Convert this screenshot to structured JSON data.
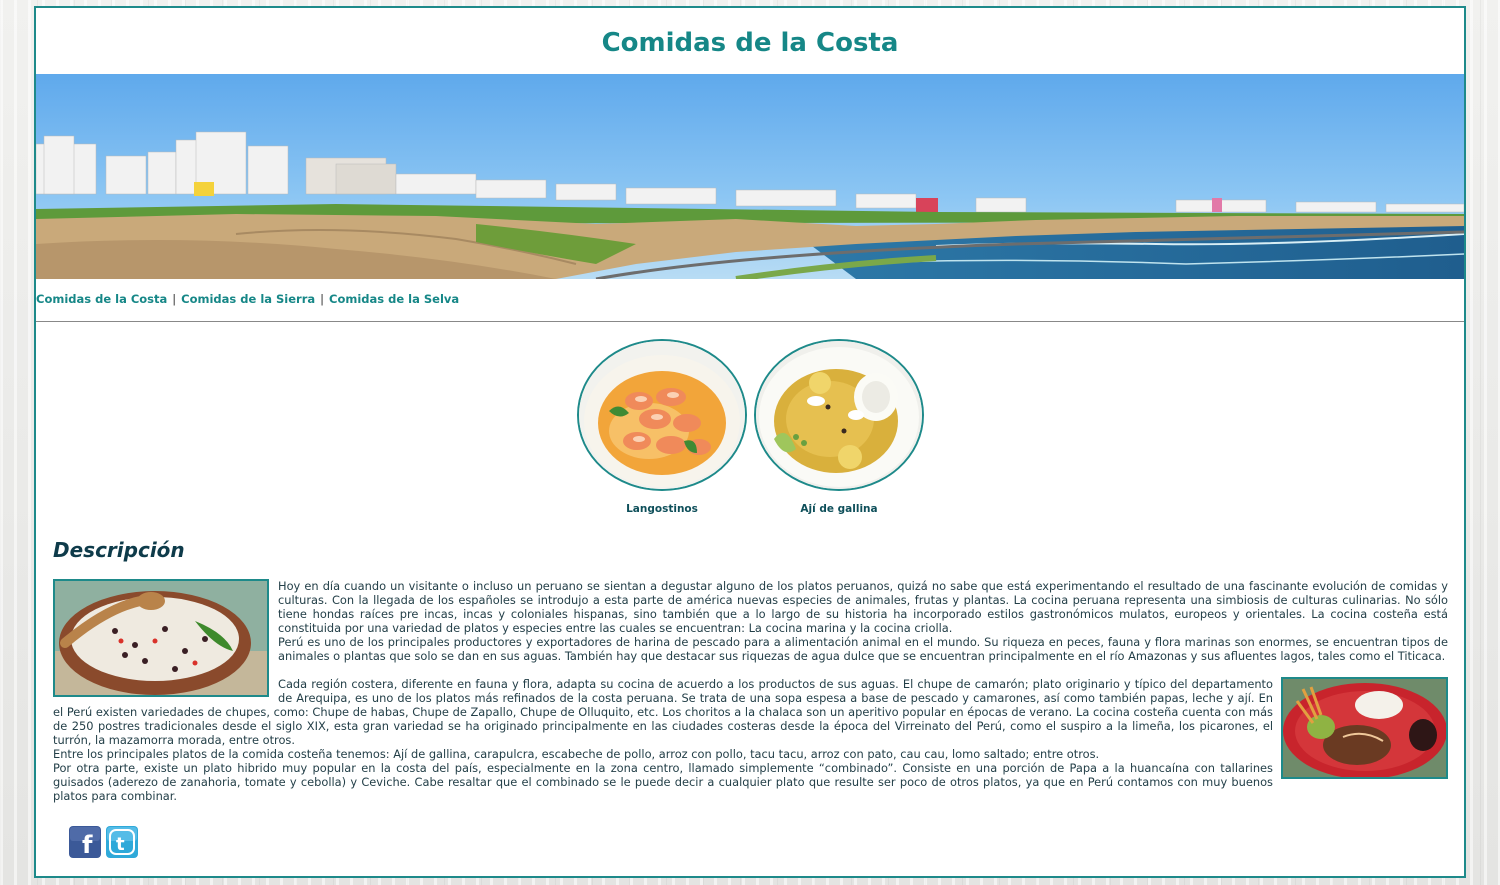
{
  "header": {
    "title": "Comidas de la Costa"
  },
  "nav": {
    "items": [
      {
        "label": "Comidas de la Costa"
      },
      {
        "label": "Comidas de la Sierra"
      },
      {
        "label": "Comidas de la Selva"
      }
    ],
    "separator": "|"
  },
  "gallery": [
    {
      "caption": "Langostinos"
    },
    {
      "caption": "Ají de gallina"
    }
  ],
  "description": {
    "heading": "Descripción",
    "paragraphs": [
      "Hoy en día cuando un visitante o incluso un peruano se sientan a degustar alguno de los platos peruanos, quizá no sabe que está experimentando el resultado de una fascinante evolución de comidas y culturas. Con la llegada de los españoles se introdujo a esta parte de américa nuevas especies de animales, frutas y plantas. La cocina peruana representa una simbiosis de culturas culinarias. No sólo tiene hondas raíces pre incas, incas y coloniales hispanas, sino también que a lo largo de su historia ha incorporado estilos gastronómicos mulatos, europeos y orientales. La cocina costeña está constituida por una variedad de platos y especies entre las cuales se encuentran: La cocina marina y la cocina criolla.",
      "Perú es uno de los principales productores y exportadores de harina de pescado para a alimentación animal en el mundo. Su riqueza en peces, fauna y flora marinas son enormes, se encuentran tipos de animales o plantas que solo se dan en sus aguas. También hay que destacar sus riquezas de agua dulce que se encuentran principalmente en el río Amazonas y sus afluentes lagos, tales como el Titicaca.",
      "Cada región costera, diferente en fauna y flora, adapta su cocina de acuerdo a los productos de sus aguas. El chupe de camarón; plato originario y típico del departamento de Arequipa, es uno de los platos más refinados de la costa peruana. Se trata de una sopa espesa a base de pescado y camarones, así como también papas, leche y ají. En el Perú existen variedades de chupes, como: Chupe de habas, Chupe de Zapallo, Chupe de Olluquito, etc. Los choritos a la chalaca son un aperitivo popular en épocas de verano. La cocina costeña cuenta con más de 250 postres tradicionales desde el siglo XIX, esta gran variedad se ha originado principalmente en las ciudades costeras desde la época del Virreinato del Perú, como el suspiro a la limeña, los picarones, el turrón, la mazamorra morada, entre otros.",
      "Entre los principales platos de la comida costeña tenemos: Ají de gallina, carapulcra, escabeche de pollo, arroz con pollo, tacu tacu, arroz con pato, cau cau, lomo saltado; entre otros.",
      "Por otra parte, existe un plato hibrido muy popular en la costa del país, especialmente en la zona centro, llamado simplemente “combinado”. Consiste en una porción de Papa a la huancaína con tallarines guisados (aderezo de zanahoria, tomate y cebolla) y Ceviche. Cabe resaltar que el combinado se le puede decir a cualquier plato que resulte ser poco de otros platos, ya que en Perú contamos con muy buenos platos para combinar."
    ]
  },
  "social": [
    {
      "icon": "facebook-icon",
      "glyph": "f",
      "color": "#3b5998"
    },
    {
      "icon": "twitter-icon",
      "glyph": "t",
      "color": "#2fa9d9"
    }
  ],
  "colors": {
    "accent": "#168787",
    "border": "#1e8a8a",
    "text": "#233f48"
  }
}
